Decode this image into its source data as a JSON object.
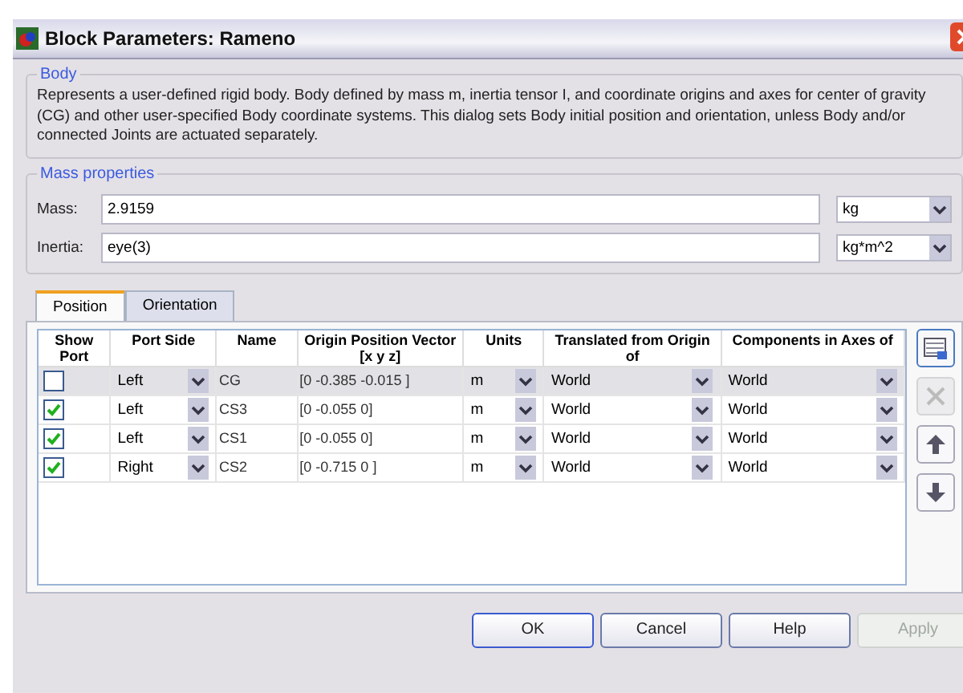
{
  "window": {
    "title": "Block Parameters: Rameno"
  },
  "body": {
    "legend": "Body",
    "description": "Represents a user-defined rigid body. Body defined by mass m, inertia tensor I, and coordinate origins and axes for center of gravity (CG) and other user-specified Body coordinate systems. This dialog sets Body initial position and orientation, unless Body and/or connected Joints are actuated separately."
  },
  "mass_properties": {
    "legend": "Mass properties",
    "fields": [
      {
        "label": "Mass:",
        "value": "2.9159",
        "unit": "kg"
      },
      {
        "label": "Inertia:",
        "value": "eye(3)",
        "unit": "kg*m^2"
      }
    ]
  },
  "tabs": [
    {
      "label": "Position",
      "selected": true
    },
    {
      "label": "Orientation",
      "selected": false
    }
  ],
  "table": {
    "columns": [
      "Show Port",
      "Port Side",
      "Name",
      "Origin Position Vector [x y z]",
      "Units",
      "Translated from Origin of",
      "Components in Axes of"
    ],
    "rows": [
      {
        "show_port": false,
        "port_side": "Left",
        "name": "CG",
        "origin": "[0 -0.385 -0.015 ]",
        "units": "m",
        "translated_from": "World",
        "components_in": "World",
        "selected": true
      },
      {
        "show_port": true,
        "port_side": "Left",
        "name": "CS3",
        "origin": "[0 -0.055 0]",
        "units": "m",
        "translated_from": "World",
        "components_in": "World",
        "selected": false
      },
      {
        "show_port": true,
        "port_side": "Left",
        "name": "CS1",
        "origin": "[0 -0.055 0]",
        "units": "m",
        "translated_from": "World",
        "components_in": "World",
        "selected": false
      },
      {
        "show_port": true,
        "port_side": "Right",
        "name": "CS2",
        "origin": "[0 -0.715 0 ]",
        "units": "m",
        "translated_from": "World",
        "components_in": "World",
        "selected": false
      }
    ]
  },
  "side_buttons": [
    {
      "kind": "add",
      "disabled": false
    },
    {
      "kind": "delete",
      "disabled": true
    },
    {
      "kind": "up",
      "disabled": false
    },
    {
      "kind": "down",
      "disabled": false
    }
  ],
  "buttons": [
    {
      "label": "OK",
      "disabled": false,
      "default": true
    },
    {
      "label": "Cancel",
      "disabled": false,
      "default": false
    },
    {
      "label": "Help",
      "disabled": false,
      "default": false
    },
    {
      "label": "Apply",
      "disabled": true,
      "default": false
    }
  ]
}
